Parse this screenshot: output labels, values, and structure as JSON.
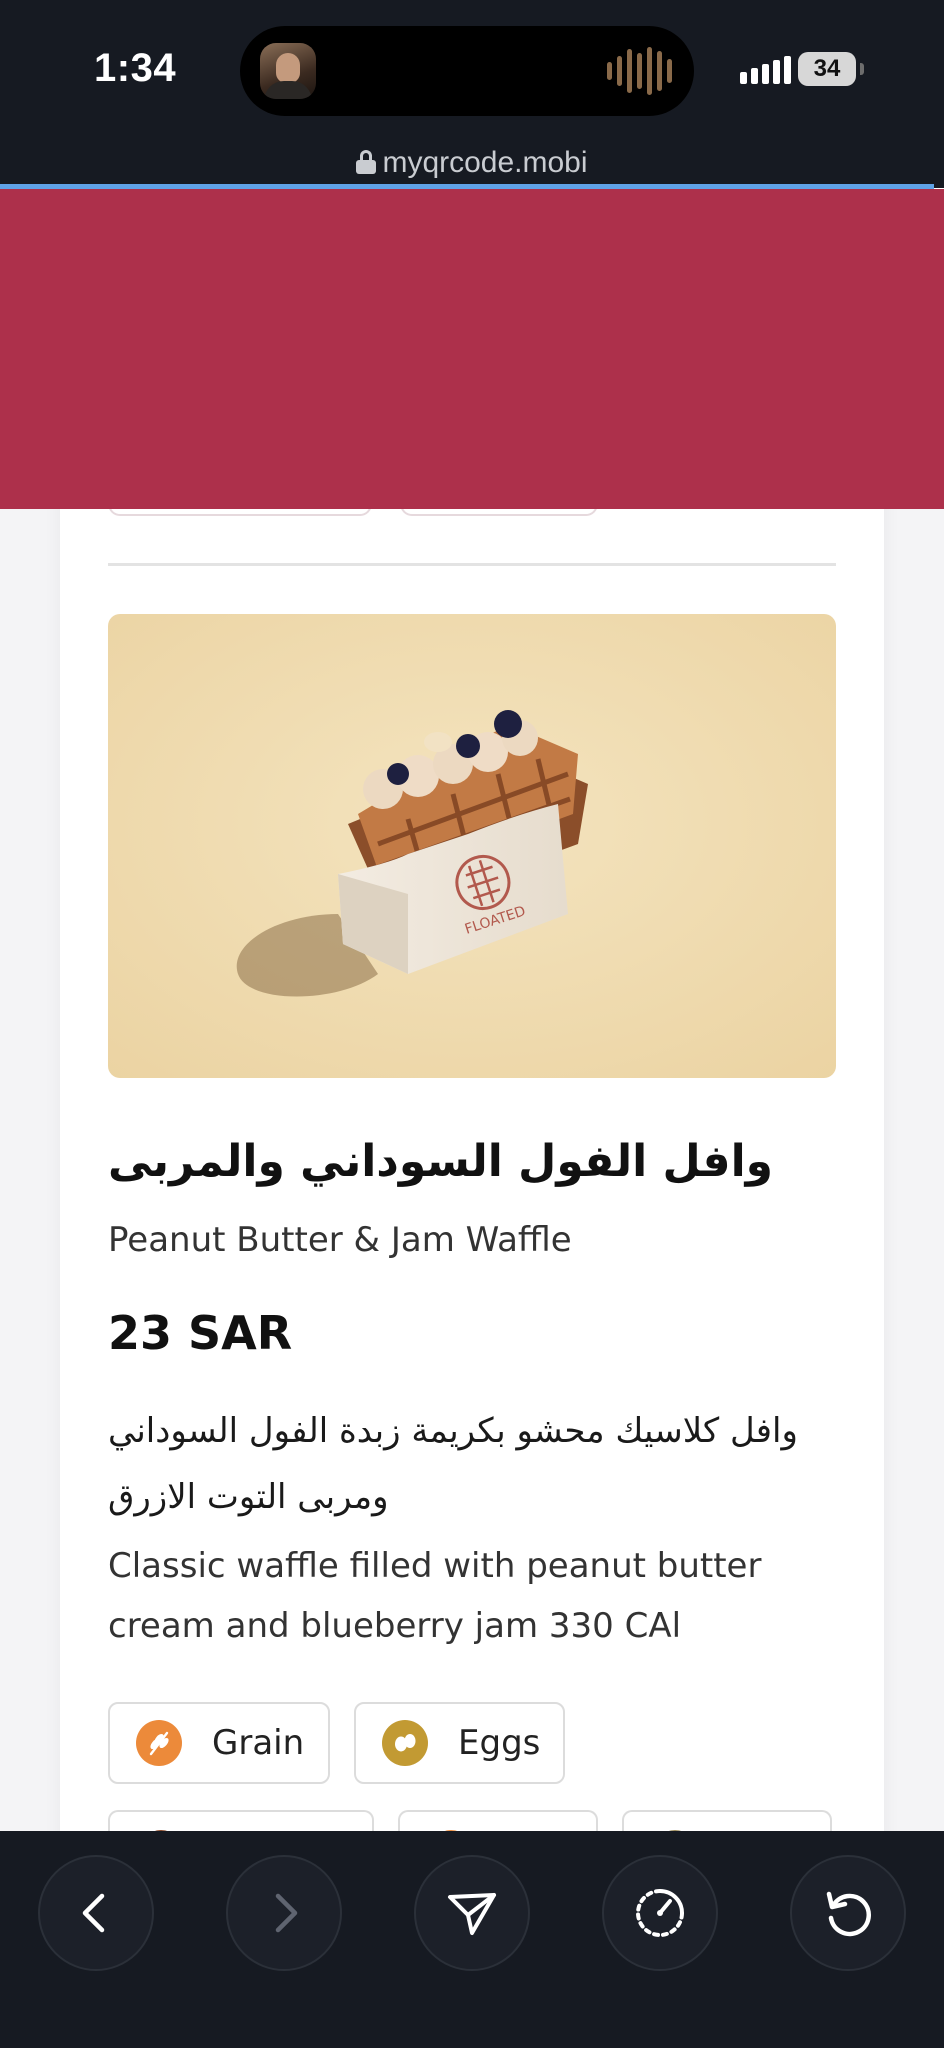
{
  "status_bar": {
    "time": "1:34",
    "battery": "34",
    "icons": [
      "contact-avatar-icon",
      "audio-waveform-icon",
      "cellular-signal-icon",
      "battery-icon"
    ]
  },
  "browser": {
    "url": "myqrcode.mobi",
    "lock_icon": "lock-icon"
  },
  "banner": {
    "color": "#ad304b"
  },
  "product": {
    "image_icon": "waffle-product-photo",
    "name_ar": "وافل الفول السوداني والمربى",
    "name_en": "Peanut Butter & Jam Waffle",
    "price": "23 SAR",
    "description_ar": "وافل كلاسيك محشو بكريمة زبدة الفول السوداني ومربى التوت الازرق",
    "description_en": "Classic waffle filled with peanut butter cream and blueberry jam 330 CAl"
  },
  "allergens": [
    {
      "label": "Grain",
      "icon": "wheat-icon",
      "color": "#ec8a3a"
    },
    {
      "label": "Eggs",
      "icon": "eggs-icon",
      "color": "#c29a33"
    }
  ],
  "toolbar": {
    "buttons": [
      {
        "name": "back",
        "icon": "chevron-left-icon"
      },
      {
        "name": "forward",
        "icon": "chevron-right-icon"
      },
      {
        "name": "share",
        "icon": "send-icon"
      },
      {
        "name": "speed",
        "icon": "gauge-icon"
      },
      {
        "name": "reload",
        "icon": "reload-icon"
      }
    ]
  },
  "colors": {
    "accent": "#ad304b",
    "chrome": "#161a22",
    "progress": "#5fa2e6"
  }
}
